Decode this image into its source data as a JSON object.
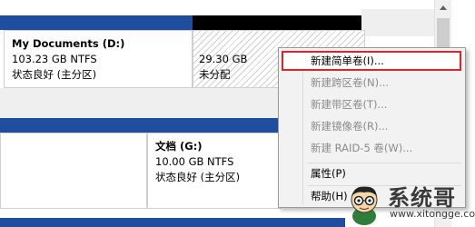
{
  "disk_top": {
    "partition_d": {
      "name": "My Documents  (D:)",
      "size": "103.23 GB NTFS",
      "status": "状态良好 (主分区)"
    },
    "unallocated": {
      "size": "29.30 GB",
      "status": "未分配"
    }
  },
  "disk_bottom": {
    "partition_g": {
      "name": "文档  (G:)",
      "size": "10.00 GB NTFS",
      "status": "状态良好 (主分区)"
    }
  },
  "context_menu": {
    "items": [
      {
        "label": "新建简单卷(I)...",
        "enabled": true,
        "highlighted": true
      },
      {
        "label": "新建跨区卷(N)...",
        "enabled": false
      },
      {
        "label": "新建带区卷(T)...",
        "enabled": false
      },
      {
        "label": "新建镜像卷(R)...",
        "enabled": false
      },
      {
        "label": "新建 RAID-5 卷(W)...",
        "enabled": false
      },
      {
        "label": "属性(P)",
        "enabled": true
      },
      {
        "label": "帮助(H)",
        "enabled": true
      }
    ]
  },
  "logo": {
    "title": "系统哥",
    "url": "www.xitongge.com"
  },
  "colors": {
    "header_blue": "#1f4e9e",
    "highlight_red": "#e0222a"
  }
}
